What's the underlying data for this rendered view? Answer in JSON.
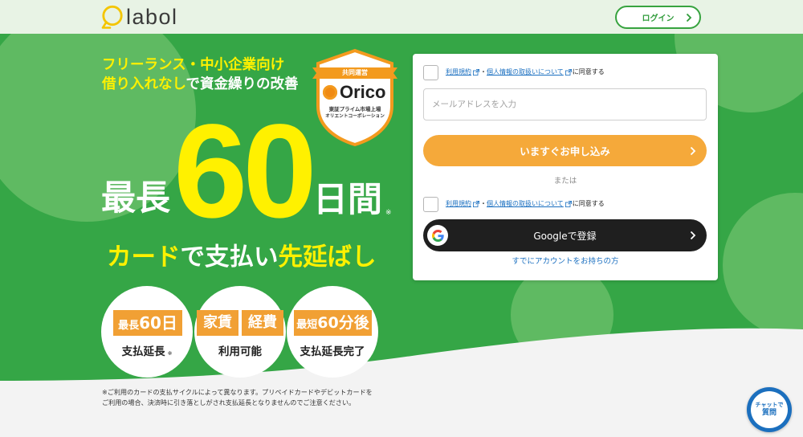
{
  "header": {
    "logo_text": "labol",
    "login_label": "ログイン"
  },
  "hero": {
    "tagline_1": "フリーランス・中小企業向け",
    "tagline_2_highlight": "借り入れなし",
    "tagline_2_rest": "で資金繰りの改善",
    "badge": {
      "ribbon": "共同運営",
      "brand": "Orico",
      "line_1": "東証プライム市場上場",
      "line_2": "オリエントコーポレーション"
    },
    "headline": {
      "prefix": "最長",
      "number": "60",
      "suffix": "日間",
      "note_mark": "※"
    },
    "subheadline": {
      "part_1": "カード",
      "part_2": "で支払い",
      "part_3": "先延ばし"
    },
    "features": [
      {
        "tag_pre": "最長",
        "tag_main": "60日",
        "caption": "支払延長",
        "caption_mark": "※"
      },
      {
        "tags": [
          "家賃",
          "経費"
        ],
        "caption": "利用可能"
      },
      {
        "tag_pre": "最短",
        "tag_main": "60分後",
        "caption": "支払延長完了"
      }
    ],
    "footnote": [
      "※ご利用のカードの支払サイクルによって異なります。プリペイドカードやデビットカードを",
      "ご利用の場合、決済時に引き落としがされ支払延長となりませんのでご注意ください。"
    ]
  },
  "signup_form": {
    "consent_terms_link": "利用規約",
    "consent_separator": "・",
    "consent_privacy_link": "個人情報の取扱いについて",
    "consent_suffix": "に同意する",
    "email_placeholder": "メールアドレスを入力",
    "email_value": "",
    "apply_button_label": "いますぐお申し込み",
    "divider_label": "または",
    "google_button_label": "Googleで登録",
    "existing_account_link": "すでにアカウントをお持ちの方"
  },
  "chat_widget": {
    "line_1": "チャットで",
    "line_2": "質問"
  },
  "icons": {
    "logo": "labol-logo-icon",
    "external_link": "external-link-icon",
    "chevron": "chevron-right-icon",
    "google": "google-icon"
  },
  "colors": {
    "hero_green": "#35a646",
    "hero_green_light": "#5fba62",
    "accent_yellow": "#fff100",
    "button_orange": "#f5a93a",
    "tag_orange": "#f1a034",
    "dark_button": "#1f1f1f",
    "link_blue": "#1a6fc0",
    "chat_blue": "#1b6fbe"
  }
}
